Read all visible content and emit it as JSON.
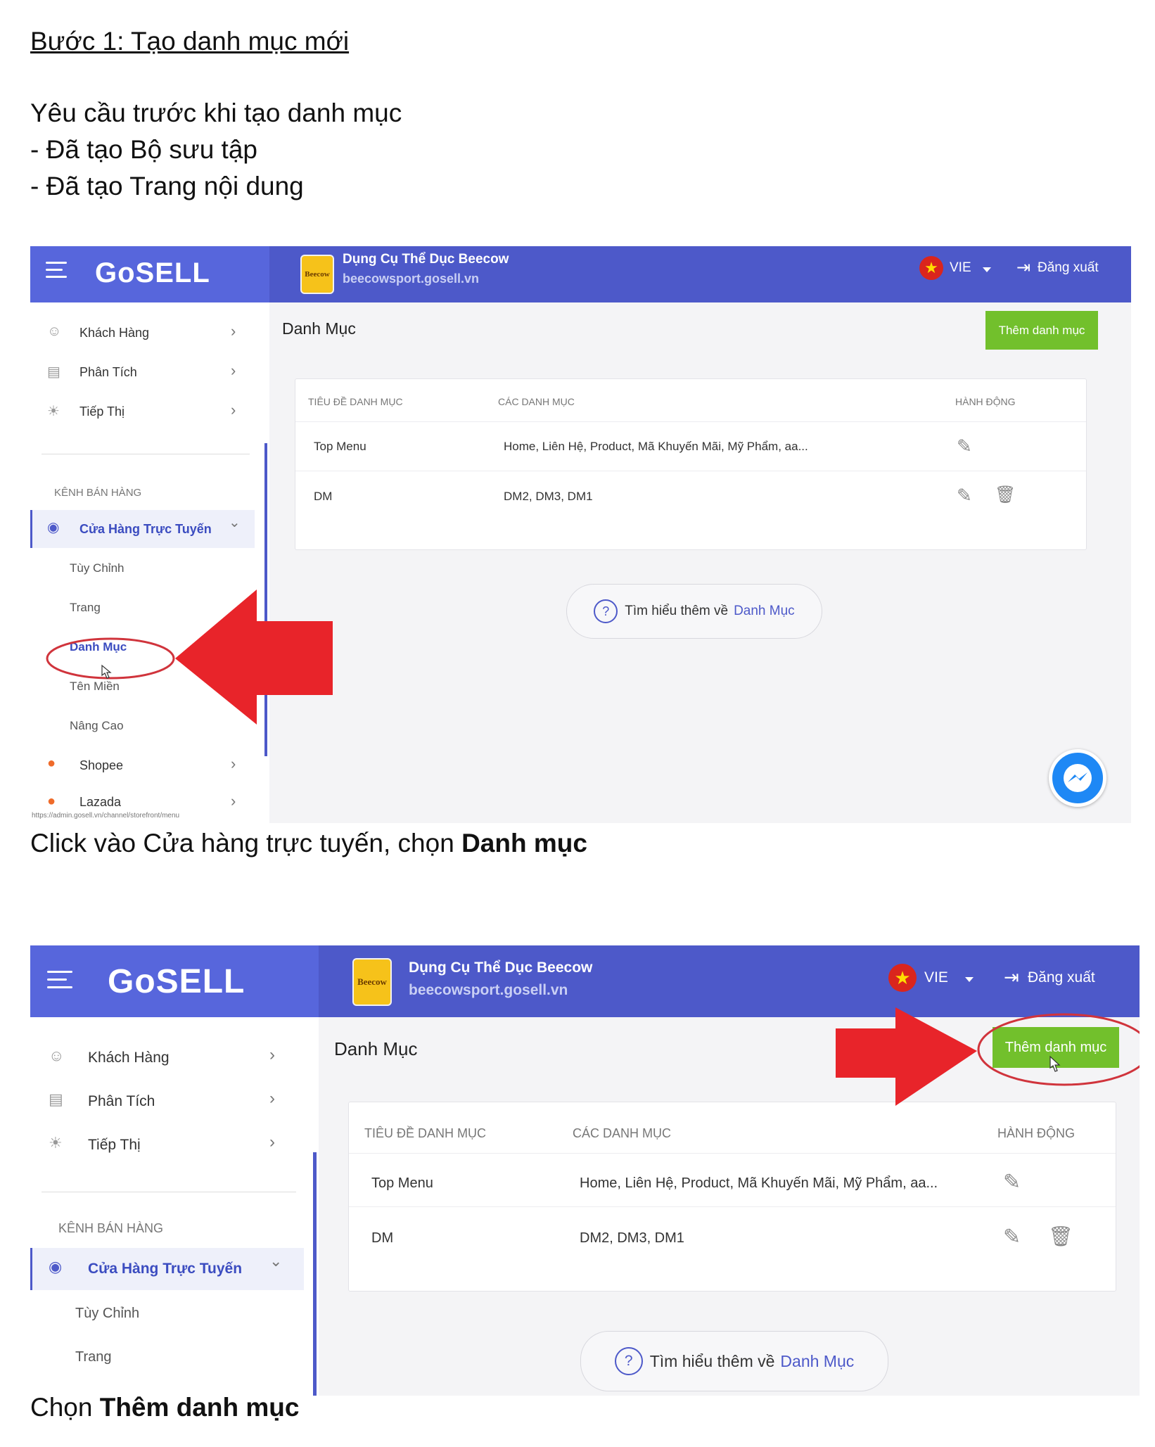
{
  "doc": {
    "step_title": "Bước 1: Tạo danh mục mới",
    "requirement_intro": "Yêu cầu trước khi tạo danh mục",
    "requirements": [
      "-  Đã tạo Bộ sưu tập",
      "-  Đã tạo Trang nội dung"
    ],
    "caption1_plain": "Click vào Cửa hàng trực tuyến, chọn ",
    "caption1_bold": "Danh mục",
    "caption2_plain": "Chọn ",
    "caption2_bold": "Thêm danh mục"
  },
  "app": {
    "logo": "GoSELL",
    "store_logo": "Beecow",
    "store_name": "Dụng Cụ Thể Dục Beecow",
    "store_url": "beecowsport.gosell.vn",
    "flag_star": "★",
    "language": "VIE",
    "logout": "Đăng xuất",
    "logout_icon": "⇥",
    "chevron": "›",
    "chevron_down": "⌄",
    "sidebar": {
      "customers": "Khách Hàng",
      "analytics": "Phân Tích",
      "marketing": "Tiếp Thị",
      "section": "KÊNH BÁN HÀNG",
      "online_store": "Cửa Hàng Trực Tuyến",
      "customize": "Tùy Chỉnh",
      "pages": "Trang",
      "menus": "Danh Mục",
      "domains": "Tên Miền",
      "advanced": "Nâng Cao",
      "shopee": "Shopee",
      "lazada": "Lazada",
      "status_url": "https://admin.gosell.vn/channel/storefront/menu"
    },
    "content": {
      "title": "Danh Mục",
      "add_button": "Thêm danh mục",
      "columns": [
        "TIÊU ĐỀ DANH MỤC",
        "CÁC DANH MỤC",
        "HÀNH ĐỘNG"
      ],
      "rows": [
        {
          "title": "Top Menu",
          "items": "Home, Liên Hệ, Product, Mã Khuyến Mãi, Mỹ Phẩm, aa..."
        },
        {
          "title": "DM",
          "items": "DM2, DM3, DM1"
        }
      ],
      "edit_icon": "✎",
      "delete_icon": "🗑",
      "help_q": "?",
      "help_text": "Tìm hiểu thêm về",
      "help_link": "Danh Mục"
    }
  },
  "colors": {
    "topbar": "#4d59c9",
    "logo_area": "#5766dc",
    "accent_green": "#72c02c",
    "arrow_red": "#e8242a",
    "highlight_ring": "#d0343c"
  }
}
